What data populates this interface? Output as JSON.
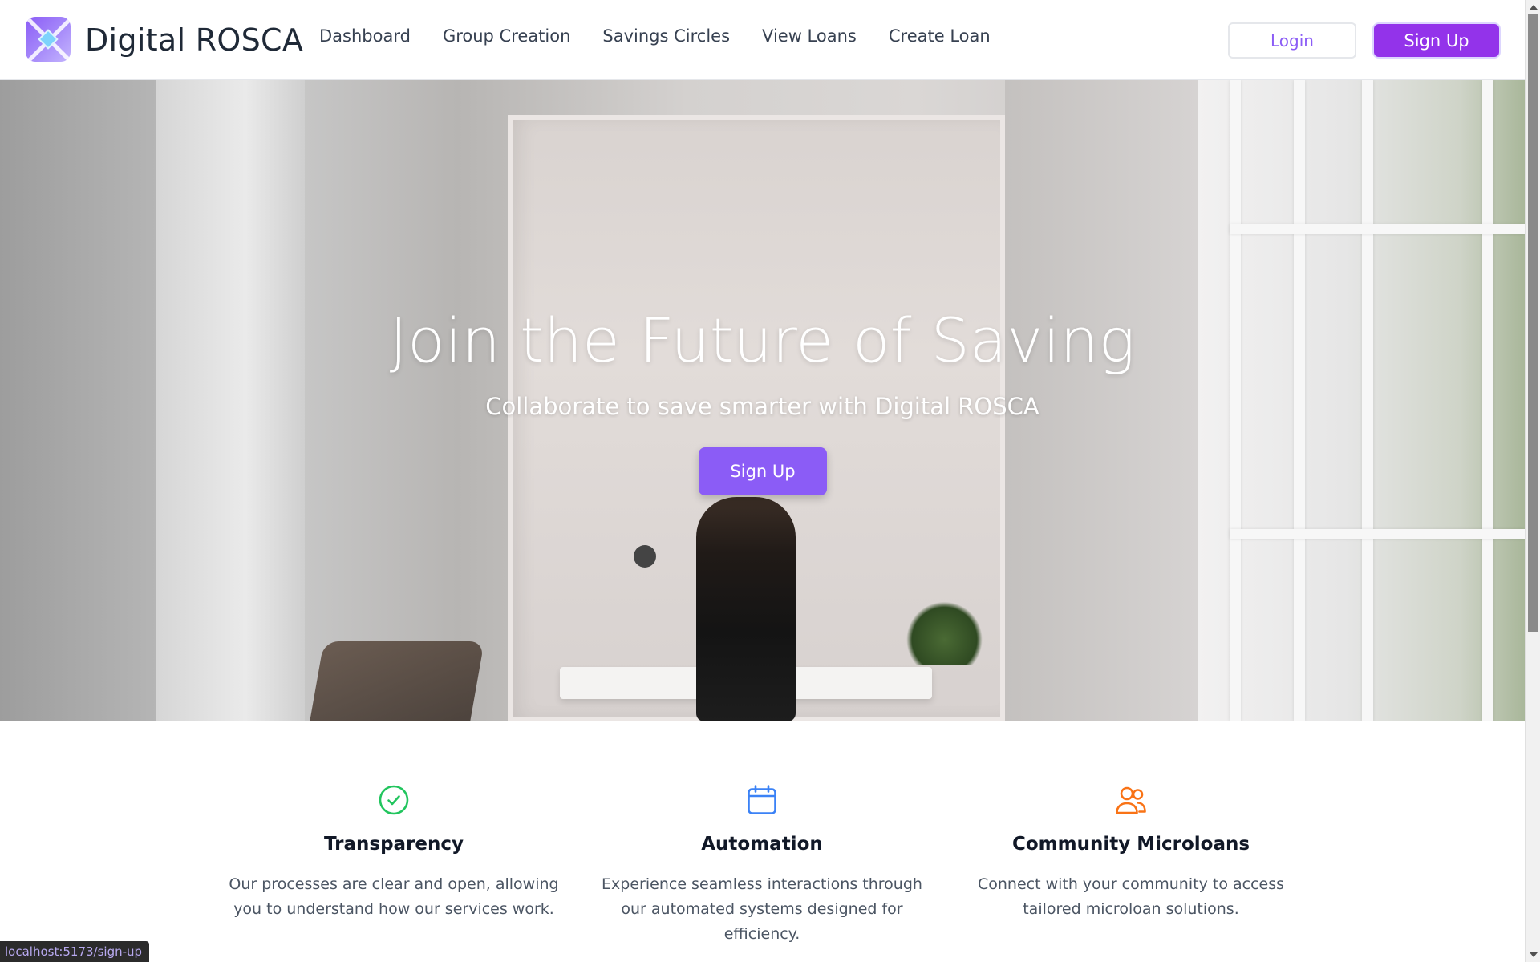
{
  "header": {
    "brand": "Digital ROSCA",
    "logo_icon": "rosca-logo-icon",
    "nav": [
      {
        "label": "Dashboard"
      },
      {
        "label": "Group Creation"
      },
      {
        "label": "Savings Circles"
      },
      {
        "label": "View Loans"
      },
      {
        "label": "Create Loan"
      }
    ],
    "login_label": "Login",
    "signup_label": "Sign Up"
  },
  "hero": {
    "title": "Join the Future of Saving",
    "subtitle": "Collaborate to save smarter with Digital ROSCA",
    "cta_label": "Sign Up"
  },
  "features": [
    {
      "icon": "check-circle-icon",
      "title": "Transparency",
      "description": "Our processes are clear and open, allowing you to understand how our services work.",
      "color": "#22c55e"
    },
    {
      "icon": "calendar-icon",
      "title": "Automation",
      "description": "Experience seamless interactions through our automated systems designed for efficiency.",
      "color": "#3b82f6"
    },
    {
      "icon": "users-icon",
      "title": "Community Microloans",
      "description": "Connect with your community to access tailored microloan solutions.",
      "color": "#f97316"
    }
  ],
  "status_bar": {
    "url": "localhost:5173/sign-up"
  },
  "colors": {
    "accent": "#8b5cf6",
    "signup_top": "#9333ea"
  }
}
